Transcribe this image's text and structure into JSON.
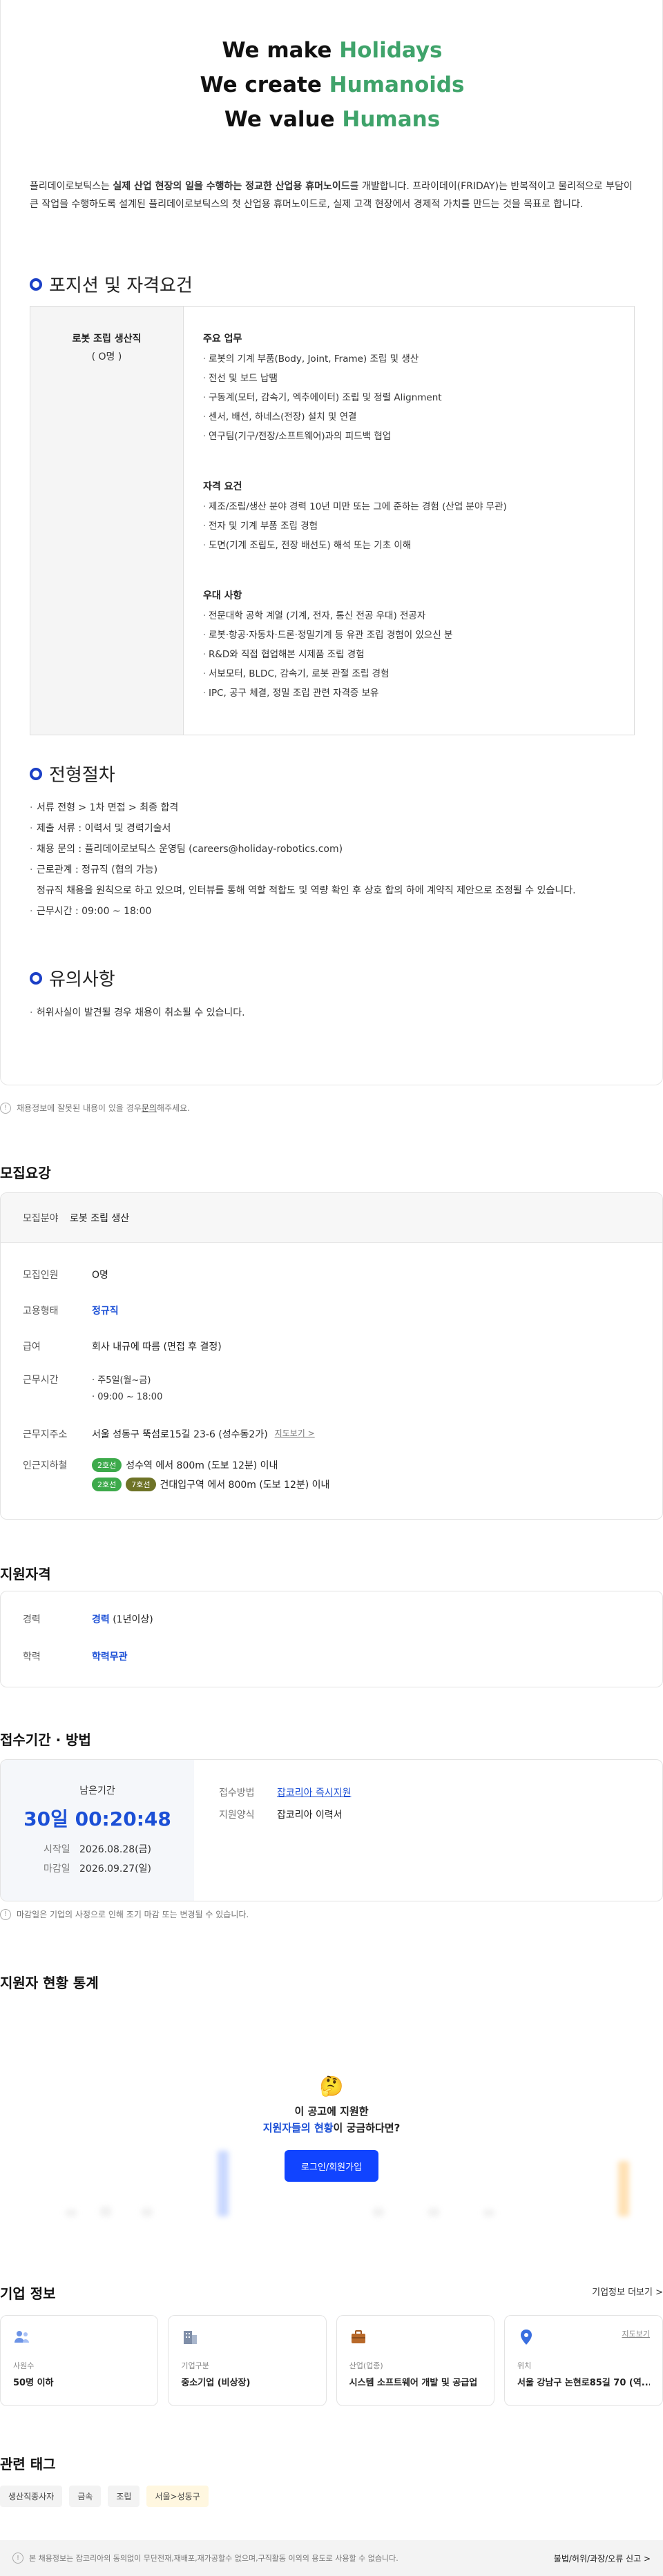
{
  "hero": {
    "line1_a": "We make ",
    "line1_b": "Holidays",
    "line2_a": "We create ",
    "line2_b": "Humanoids",
    "line3_a": "We value ",
    "line3_b": "Humans"
  },
  "intro": {
    "p1": "플리데이로보틱스는 ",
    "p2": "실제 산업 현장의 일을 수행하는 정교한 산업용 휴머노이드",
    "p3": "를 개발합니다. 프라이데이(FRIDAY)는 반복적이고 물리적으로 부담이 큰 작업을 수행하도록 설계된 플리데이로보틱스의 첫 산업용 휴머노이드로, 실제 고객 현장에서 경제적 가치를 만드는 것을 목표로 합니다."
  },
  "section_position": "포지션 및 자격요건",
  "position": {
    "name": "로봇 조립 생산직",
    "count": "( O명 )",
    "groups": [
      {
        "title": "주요 업무",
        "items": [
          "로봇의 기계 부품(Body, Joint, Frame) 조립 및 생산",
          "전선 및 보드 납땜",
          "구동계(모터, 감속기, 엑추에이터) 조립 및 정렬 Alignment",
          "센서, 배선, 하네스(전장) 설치 및 연결",
          "연구팀(기구/전장/소프트웨어)과의 피드백 협업"
        ]
      },
      {
        "title": "자격 요건",
        "items": [
          "제조/조립/생산 분야 경력 10년 미만 또는 그에 준하는 경험 (산업 분야 무관)",
          "전자 및 기계 부품 조립 경험",
          "도면(기계 조립도, 전장 배선도) 해석 또는 기초 이해"
        ]
      },
      {
        "title": "우대 사항",
        "items": [
          "전문대학 공학 계열 (기계, 전자, 통신 전공 우대) 전공자",
          "로봇·항공·자동차·드론·정밀기계 등 유관 조립 경험이 있으신 분",
          "R&D와 직접 협업해본 시제품 조립 경험",
          "서보모터, BLDC, 감속기, 로봇 관절 조립 경험",
          "IPC, 공구 체결, 정밀 조립 관련 자격증 보유"
        ]
      }
    ]
  },
  "section_process": "전형절차",
  "process": {
    "items": [
      "서류 전형 > 1차 면접 > 최종 합격",
      "제출 서류 : 이력서 및 경력기술서",
      "채용 문의 : 플리데이로보틱스 운영팀 (careers@holiday-robotics.com)",
      "근로관계 : 정규직 (협의 가능)"
    ],
    "sub": "정규직 채용을 원칙으로 하고 있으며, 인터뷰를 통해 역할 적합도 및 역량 확인 후 상호 합의 하에 계약직 제안으로 조정될 수 있습니다.",
    "last": "근무시간 : 09:00 ~ 18:00"
  },
  "section_notes": "유의사항",
  "notes": {
    "item": "허위사실이 발견될 경우 채용이 취소될 수 있습니다."
  },
  "correction": {
    "pre": "채용정보에 잘못된 내용이 있을 경우 ",
    "link": "문의",
    "post": "해주세요."
  },
  "recruit": {
    "heading": "모집요강",
    "field_label": "모집분야",
    "field_value": "로봇 조립 생산",
    "people_label": "모집인원",
    "people_value": "O명",
    "type_label": "고용형태",
    "type_value": "정규직",
    "pay_label": "급여",
    "pay_value": "회사 내규에 따름 (면접 후 결정)",
    "hours_label": "근무시간",
    "hours_days": "· 주5일(월~금)",
    "hours_time": "· 09:00 ~ 18:00",
    "address_label": "근무지주소",
    "address_value": "서울 성동구 뚝섬로15길 23-6 (성수동2가)",
    "map_link": "지도보기 >",
    "subway_label": "인근지하철",
    "subway1_badge": "2호선",
    "subway1_text": "성수역 에서 800m (도보 12분) 이내",
    "subway2_badge1": "2호선",
    "subway2_badge2": "7호선",
    "subway2_text": "건대입구역 에서 800m (도보 12분) 이내"
  },
  "qual": {
    "heading": "지원자격",
    "career_label": "경력",
    "career_value": "경력",
    "career_extra": " (1년이상)",
    "edu_label": "학력",
    "edu_value": "학력무관"
  },
  "period": {
    "heading": "접수기간 · 방법",
    "remain_label": "남은기간",
    "remain_time": "30일 00:20:48",
    "start_label": "시작일",
    "start_value": "2026.08.28(금)",
    "end_label": "마감일",
    "end_value": "2026.09.27(일)",
    "method_label": "접수방법",
    "method_value": "잡코리아 즉시지원",
    "form_label": "지원양식",
    "form_value": "잡코리아 이력서",
    "note": "마감일은 기업의 사정으로 인해 조기 마감 또는 변경될 수 있습니다."
  },
  "stats": {
    "heading": "지원자 현황 통계",
    "q1": "이 공고에 지원한",
    "q2a": "지원자들의 현황",
    "q2b": "이 궁금하다면?",
    "login": "로그인/회원가입"
  },
  "company": {
    "heading": "기업 정보",
    "more": "기업정보 더보기 >",
    "cards": [
      {
        "icon": "people-icon",
        "label": "사원수",
        "value": "50명 이하"
      },
      {
        "icon": "building-icon",
        "label": "기업구분",
        "value": "중소기업 (비상장)"
      },
      {
        "icon": "briefcase-icon",
        "label": "산업(업종)",
        "value": "시스템 소프트웨어 개발 및 공급업"
      },
      {
        "icon": "location-pin-icon",
        "label": "위치",
        "value": "서울 강남구 논현로85길 70 (역...",
        "map": "지도보기"
      }
    ]
  },
  "tags": {
    "heading": "관련 태그",
    "items": [
      "생산직종사자",
      "금속",
      "조립",
      "서울>성동구"
    ]
  },
  "footer": {
    "notice": "본 채용정보는 잡코리아의 동의없이 무단전재,재배포,재가공할수 없으며,구직활동 이외의 용도로 사용할 수 없습니다.",
    "report": "불법/허위/과장/오류 신고 >"
  }
}
